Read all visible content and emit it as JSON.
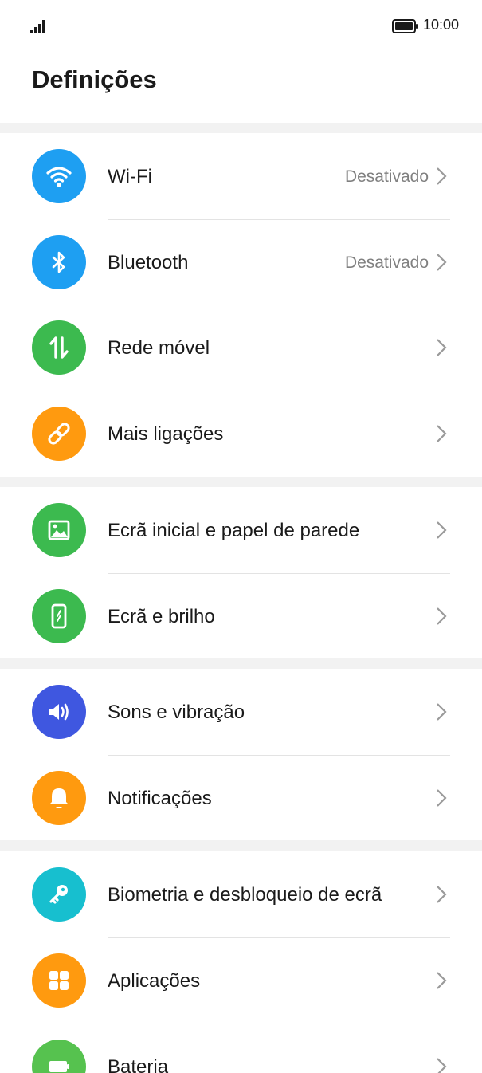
{
  "status_bar": {
    "time": "10:00",
    "icons": [
      "signal-icon",
      "battery-icon"
    ]
  },
  "header": {
    "title": "Definições"
  },
  "groups": [
    {
      "items": [
        {
          "label": "Wi-Fi",
          "value": "Desativado",
          "icon": "wifi-icon",
          "color": "#1e9ff2"
        },
        {
          "label": "Bluetooth",
          "value": "Desativado",
          "icon": "bluetooth-icon",
          "color": "#1e9ff2"
        },
        {
          "label": "Rede móvel",
          "icon": "mobile-data-icon",
          "color": "#3cba4f"
        },
        {
          "label": "Mais ligações",
          "icon": "link-icon",
          "color": "#ff9a0f"
        }
      ]
    },
    {
      "items": [
        {
          "label": "Ecrã inicial e papel de parede",
          "icon": "wallpaper-icon",
          "color": "#3cba4f"
        },
        {
          "label": "Ecrã e brilho",
          "icon": "display-brightness-icon",
          "color": "#3cba4f"
        }
      ]
    },
    {
      "items": [
        {
          "label": "Sons e vibração",
          "icon": "speaker-icon",
          "color": "#3f57e0"
        },
        {
          "label": "Notificações",
          "icon": "bell-icon",
          "color": "#ff9a0f"
        }
      ]
    },
    {
      "items": [
        {
          "label": "Biometria e desbloqueio de ecrã",
          "icon": "key-icon",
          "color": "#17bfcf"
        },
        {
          "label": "Aplicações",
          "icon": "apps-grid-icon",
          "color": "#ff9a0f"
        },
        {
          "label": "Bateria",
          "icon": "battery-settings-icon",
          "color": "#56c24f"
        }
      ]
    }
  ],
  "chevron_icon": "chevron-right-icon"
}
